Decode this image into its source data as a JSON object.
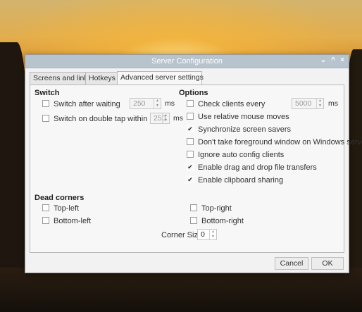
{
  "window": {
    "title": "Server Configuration",
    "controls": {
      "minimize": "⌄",
      "maximize": "^",
      "close": "×"
    }
  },
  "tabs": [
    "Screens and links",
    "Hotkeys",
    "Advanced server settings"
  ],
  "active_tab": "Advanced server settings",
  "switch": {
    "heading": "Switch",
    "after_waiting": {
      "label": "Switch after waiting",
      "checked": false,
      "value": "250",
      "unit": "ms"
    },
    "double_tap": {
      "label": "Switch on double tap within",
      "checked": false,
      "value": "250",
      "unit": "ms"
    }
  },
  "options": {
    "heading": "Options",
    "check_clients": {
      "label": "Check clients every",
      "checked": false,
      "value": "5000",
      "unit": "ms"
    },
    "items": [
      {
        "label": "Use relative mouse moves",
        "checked": false
      },
      {
        "label": "Synchronize screen savers",
        "checked": true
      },
      {
        "label": "Don't take foreground window on Windows servers",
        "checked": false
      },
      {
        "label": "Ignore auto config clients",
        "checked": false
      },
      {
        "label": "Enable drag and drop file transfers",
        "checked": true
      },
      {
        "label": "Enable clipboard sharing",
        "checked": true
      }
    ]
  },
  "dead_corners": {
    "heading": "Dead corners",
    "top_left": {
      "label": "Top-left",
      "checked": false
    },
    "top_right": {
      "label": "Top-right",
      "checked": false
    },
    "bottom_left": {
      "label": "Bottom-left",
      "checked": false
    },
    "bottom_right": {
      "label": "Bottom-right",
      "checked": false
    },
    "corner_size_label": "Corner Size:",
    "corner_size_value": "0"
  },
  "buttons": {
    "cancel": "Cancel",
    "ok": "OK"
  },
  "glyphs": {
    "check": "✔",
    "spin_up": "▲",
    "spin_down": "▼"
  }
}
